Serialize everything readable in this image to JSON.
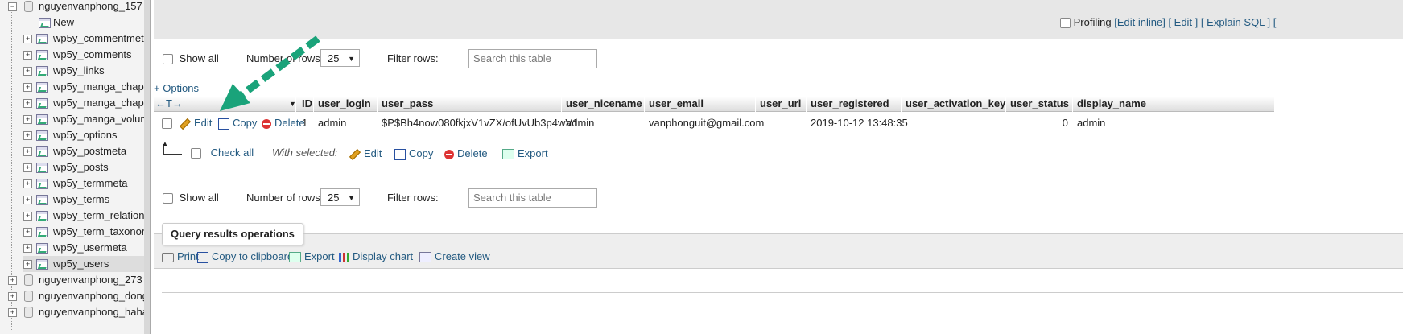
{
  "sidebar": {
    "items": [
      {
        "label": "nguyenvanphong_157",
        "kind": "db",
        "expanded": true
      },
      {
        "label": "New",
        "kind": "new"
      },
      {
        "label": "wp5y_commentmet",
        "kind": "table"
      },
      {
        "label": "wp5y_comments",
        "kind": "table"
      },
      {
        "label": "wp5y_links",
        "kind": "table"
      },
      {
        "label": "wp5y_manga_chapt",
        "kind": "table"
      },
      {
        "label": "wp5y_manga_chapt",
        "kind": "table"
      },
      {
        "label": "wp5y_manga_volun",
        "kind": "table"
      },
      {
        "label": "wp5y_options",
        "kind": "table"
      },
      {
        "label": "wp5y_postmeta",
        "kind": "table"
      },
      {
        "label": "wp5y_posts",
        "kind": "table"
      },
      {
        "label": "wp5y_termmeta",
        "kind": "table"
      },
      {
        "label": "wp5y_terms",
        "kind": "table"
      },
      {
        "label": "wp5y_term_relation",
        "kind": "table"
      },
      {
        "label": "wp5y_term_taxonor",
        "kind": "table"
      },
      {
        "label": "wp5y_usermeta",
        "kind": "table"
      },
      {
        "label": "wp5y_users",
        "kind": "table",
        "selected": true
      },
      {
        "label": "nguyenvanphong_273",
        "kind": "db"
      },
      {
        "label": "nguyenvanphong_dong",
        "kind": "db"
      },
      {
        "label": "nguyenvanphong_haha",
        "kind": "db"
      }
    ]
  },
  "topbar": {
    "profiling_label": "Profiling",
    "edit_inline": "[Edit inline]",
    "edit": "[ Edit ]",
    "explain_sql": "[ Explain SQL ]",
    "trailing": "[ "
  },
  "nav_top": {
    "show_all": "Show all",
    "number_of_rows_label": "Number of rows:",
    "number_of_rows_value": "25",
    "filter_label": "Filter rows:",
    "filter_placeholder": "Search this table"
  },
  "options_link": "+ Options",
  "sort_arrows": "←T→",
  "columns": [
    "ID",
    "user_login",
    "user_pass",
    "user_nicename",
    "user_email",
    "user_url",
    "user_registered",
    "user_activation_key",
    "user_status",
    "display_name"
  ],
  "row": {
    "actions": {
      "edit": "Edit",
      "copy": "Copy",
      "delete": "Delete"
    },
    "cells": [
      "1",
      "admin",
      "$P$Bh4now080fkjxV1vZX/ofUvUb3p4wV1",
      "admin",
      "vanphonguit@gmail.com",
      "",
      "2019-10-12 13:48:35",
      "",
      "0",
      "admin"
    ]
  },
  "bulk": {
    "check_all": "Check all",
    "with_selected": "With selected:",
    "edit": "Edit",
    "copy": "Copy",
    "delete": "Delete",
    "export": "Export"
  },
  "nav_bottom": {
    "show_all": "Show all",
    "number_of_rows_label": "Number of rows:",
    "number_of_rows_value": "25",
    "filter_label": "Filter rows:",
    "filter_placeholder": "Search this table"
  },
  "query_ops": {
    "legend": "Query results operations",
    "print": "Print",
    "copy_clipboard": "Copy to clipboard",
    "export": "Export",
    "display_chart": "Display chart",
    "create_view": "Create view"
  },
  "colors": {
    "link": "#235a81",
    "arrow": "#1aa37a"
  }
}
